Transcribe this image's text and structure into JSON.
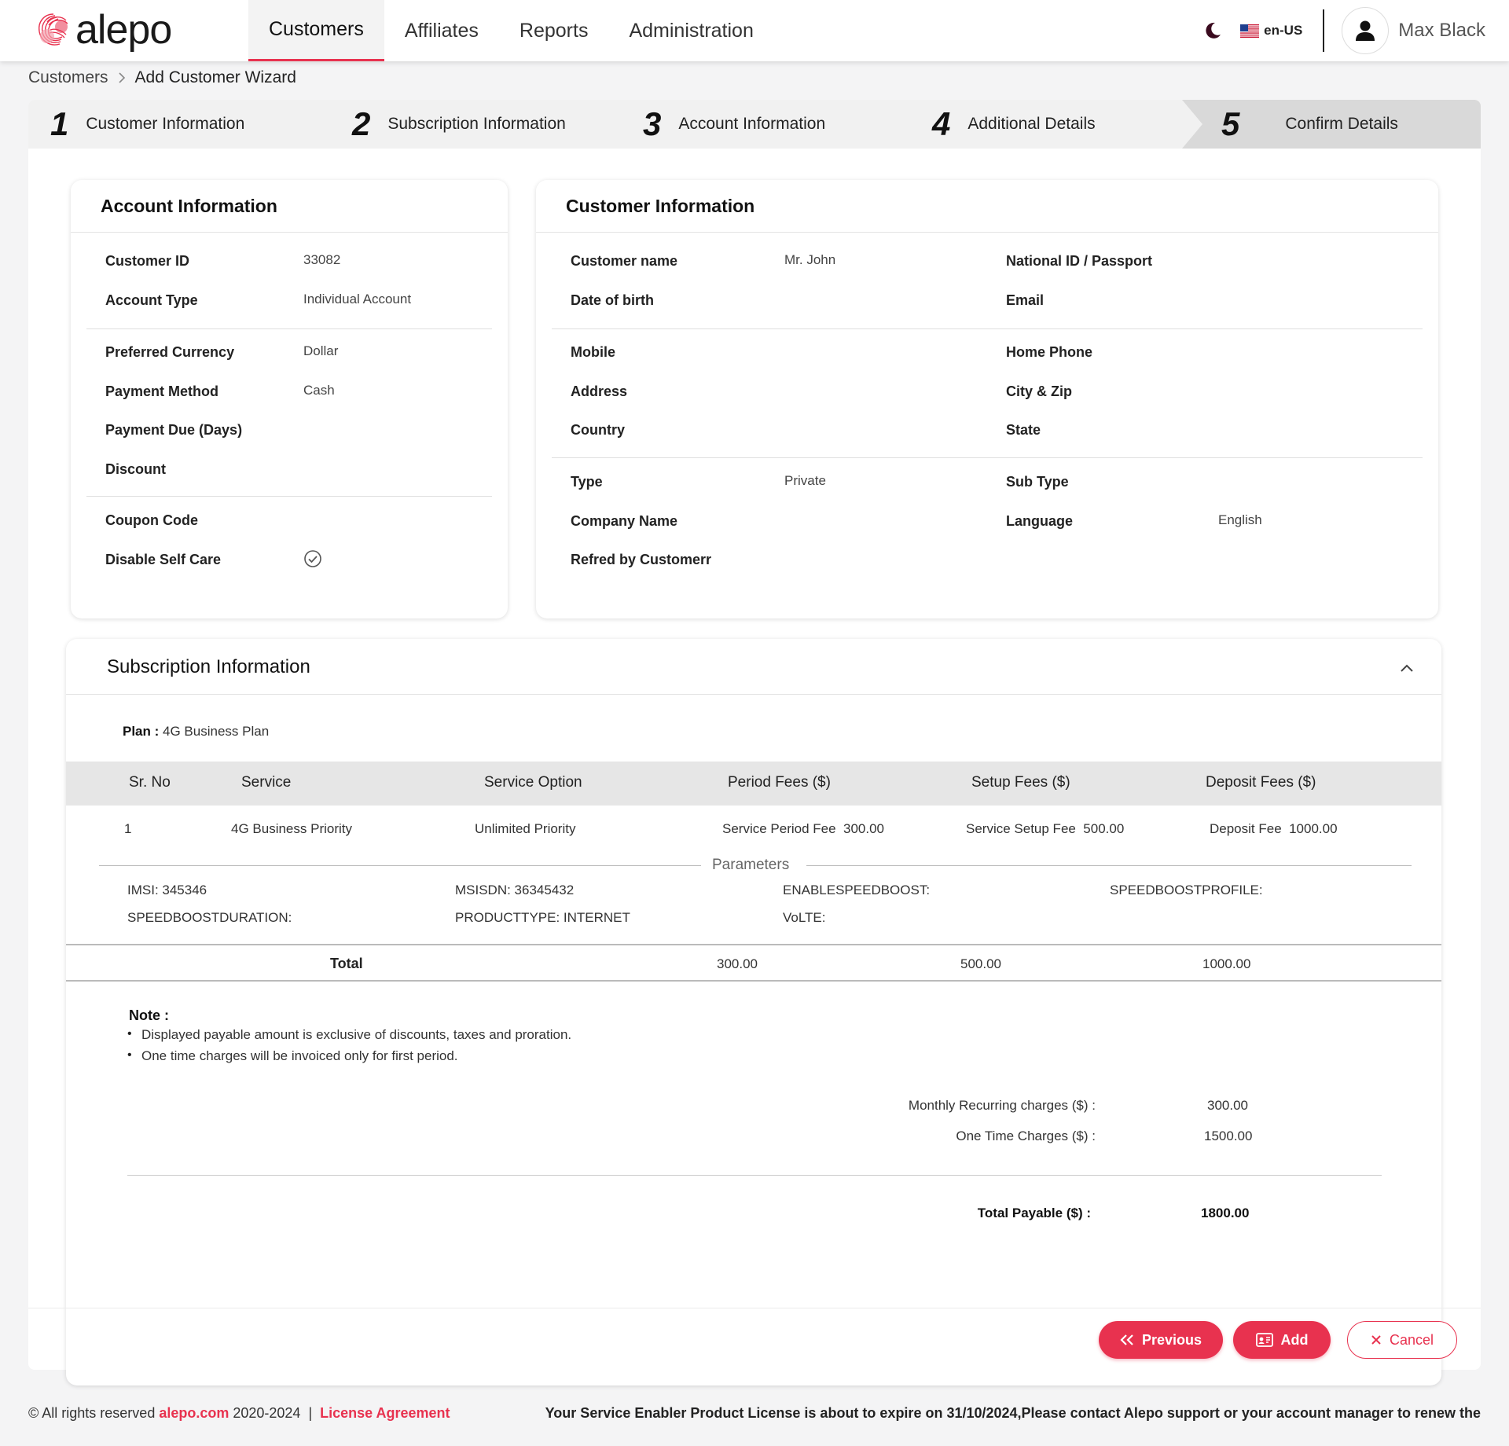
{
  "brand": {
    "name": "alepo",
    "accent": "#e8324f"
  },
  "nav": {
    "tabs": [
      "Customers",
      "Affiliates",
      "Reports",
      "Administration"
    ],
    "active": "Customers",
    "locale": "en-US",
    "user": "Max Black"
  },
  "breadcrumb": {
    "root": "Customers",
    "current": "Add Customer Wizard"
  },
  "stepper": {
    "steps": [
      {
        "num": "1",
        "label": "Customer Information"
      },
      {
        "num": "2",
        "label": "Subscription Information"
      },
      {
        "num": "3",
        "label": "Account Information"
      },
      {
        "num": "4",
        "label": "Additional Details"
      },
      {
        "num": "5",
        "label": "Confirm Details"
      }
    ],
    "active_step": "5"
  },
  "account_info": {
    "title": "Account Information",
    "customer_id_label": "Customer ID",
    "customer_id": "33082",
    "account_type_label": "Account Type",
    "account_type": "Individual Account",
    "currency_label": "Preferred Currency",
    "currency": "Dollar",
    "payment_method_label": "Payment Method",
    "payment_method": "Cash",
    "payment_due_label": "Payment Due (Days)",
    "discount_label": "Discount",
    "coupon_label": "Coupon Code",
    "self_care_label": "Disable Self Care",
    "self_care_icon": "check-circle-icon"
  },
  "customer_info": {
    "title": "Customer Information",
    "name_label": "Customer name",
    "name": "Mr. John",
    "national_id_label": "National ID / Passport",
    "dob_label": "Date of birth",
    "email_label": "Email",
    "mobile_label": "Mobile",
    "home_phone_label": "Home Phone",
    "address_label": "Address",
    "city_zip_label": "City & Zip",
    "country_label": "Country",
    "state_label": "State",
    "type_label": "Type",
    "type": "Private",
    "sub_type_label": "Sub Type",
    "company_label": "Company Name",
    "language_label": "Language",
    "language": "English",
    "referred_label": "Refred by Customerr"
  },
  "subscription": {
    "title": "Subscription Information",
    "plan_label": "Plan :",
    "plan": " 4G Business Plan",
    "columns": [
      "Sr. No",
      "Service",
      "Service Option",
      "Period Fees ($)",
      "Setup Fees ($)",
      "Deposit Fees ($)"
    ],
    "row": {
      "sr": "1",
      "service": "4G Business Priority",
      "option": "Unlimited Priority",
      "period_fee": "Service Period Fee  300.00",
      "setup_fee": "Service Setup Fee  500.00",
      "deposit_fee": "Deposit Fee  1000.00"
    },
    "parameters_label": "Parameters",
    "parameters": [
      "IMSI: 345346",
      "MSISDN: 36345432",
      "ENABLESPEEDBOOST:",
      "SPEEDBOOSTPROFILE:",
      "SPEEDBOOSTDURATION:",
      "PRODUCTTYPE: INTERNET",
      "VoLTE:"
    ],
    "total_label": "Total",
    "total_period": "300.00",
    "total_setup": "500.00",
    "total_deposit": "1000.00",
    "note_title": "Note :",
    "notes": [
      "Displayed payable amount is exclusive of discounts, taxes and proration.",
      "One time charges will be invoiced only for first period."
    ],
    "monthly_label": "Monthly Recurring charges ($) :",
    "monthly": "300.00",
    "one_time_label": "One Time Charges ($) :",
    "one_time": "1500.00",
    "total_payable_label": "Total Payable ($) :",
    "total_payable": "1800.00"
  },
  "actions": {
    "previous": "Previous",
    "add": "Add",
    "cancel": "Cancel"
  },
  "footer": {
    "rights": "© All rights reserved ",
    "site": "alepo.com",
    "years": " 2020-2024  |  ",
    "license": "License Agreement",
    "notice": "Your Service Enabler Product License is about to expire on 31/10/2024,Please contact Alepo support or your account manager to renew the"
  }
}
